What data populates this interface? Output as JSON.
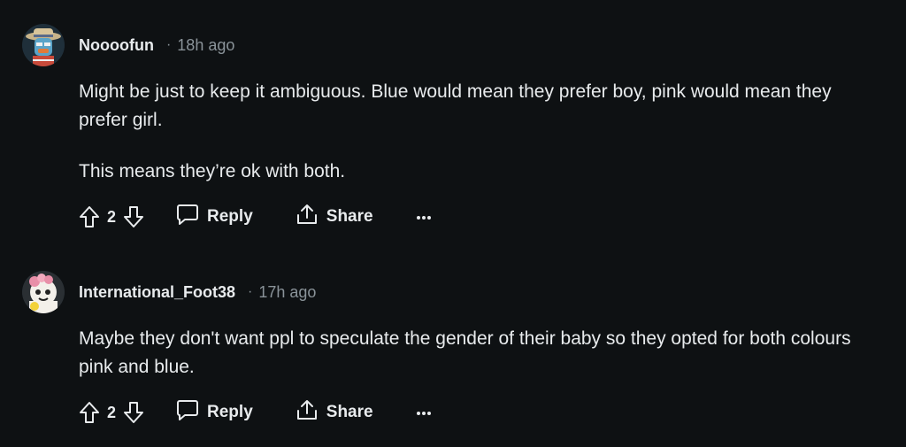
{
  "comments": [
    {
      "author": "Noooofun",
      "separator": "·",
      "time": "18h ago",
      "paragraphs": [
        "Might be just to keep it ambiguous. Blue would mean they prefer boy, pink would mean they prefer girl.",
        "This means they’re ok with both."
      ],
      "score": "2",
      "reply_label": "Reply",
      "share_label": "Share"
    },
    {
      "author": "International_Foot38",
      "separator": "·",
      "time": "17h ago",
      "paragraphs": [
        "Maybe they don't want ppl to speculate the gender of their baby so they opted for both colours pink and blue."
      ],
      "score": "2",
      "reply_label": "Reply",
      "share_label": "Share"
    }
  ],
  "icons": {
    "upvote": "arrow-up-outline",
    "downvote": "arrow-down-outline",
    "reply": "speech-bubble",
    "share": "share-upload",
    "more": "ellipsis"
  },
  "colors": {
    "background": "#0e1113",
    "text": "#e8ebed",
    "meta": "#8a9399"
  }
}
